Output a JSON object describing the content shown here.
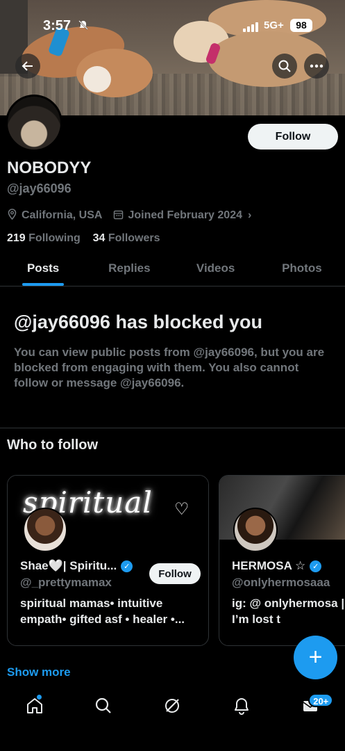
{
  "status_bar": {
    "time": "3:57",
    "network": "5G+",
    "battery": "98"
  },
  "banner": {
    "back_glyph": "←",
    "search_glyph": "⌕",
    "more_glyph": "•••"
  },
  "profile": {
    "follow_label": "Follow",
    "name": "NOBODYY",
    "handle": "@jay66096",
    "location": "California, USA",
    "joined": "Joined February 2024",
    "following_count": "219",
    "following_label": "Following",
    "followers_count": "34",
    "followers_label": "Followers"
  },
  "tabs": [
    {
      "label": "Posts"
    },
    {
      "label": "Replies"
    },
    {
      "label": "Videos"
    },
    {
      "label": "Photos"
    }
  ],
  "blocked": {
    "title": "@jay66096 has blocked you",
    "body": "You can view public posts from @jay66096, but you are blocked from engaging with them. You also cannot follow or message @jay66096."
  },
  "who_to_follow": {
    "title": "Who to follow",
    "cards": [
      {
        "banner_text": "spiritual",
        "name": "Shae🤍| Spiritu...",
        "handle": "@_prettymamax",
        "bio": "spiritual mamas• intuitive empath• gifted asf • healer •...",
        "follow_label": "Follow"
      },
      {
        "name": "HERMOSA ☆",
        "handle": "@onlyhermosaaa",
        "bio": "ig: @ onlyhermosa | follow me, I’m lost t"
      }
    ],
    "show_more": "Show more"
  },
  "fab": {
    "glyph": "+"
  },
  "bottom_nav": {
    "items": [
      "home-icon",
      "search-icon",
      "grok-icon",
      "notifications-icon",
      "messages-icon"
    ],
    "messages_badge": "20+"
  },
  "colors": {
    "accent": "#1d9bf0",
    "background": "#000000",
    "muted": "#71767b",
    "text": "#e7e9ea"
  }
}
